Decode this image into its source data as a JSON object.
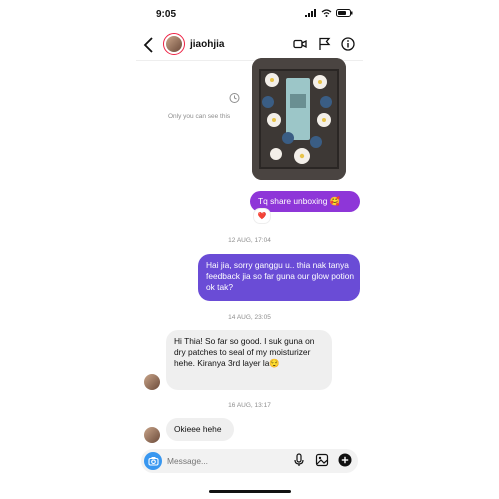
{
  "status": {
    "time": "9:05"
  },
  "header": {
    "username": "jiaohjia"
  },
  "media": {
    "note": "Only you can see this"
  },
  "messages": {
    "m1": "Tq share unboxing 🥰",
    "m1_reaction": "❤️",
    "ts1": "12 AUG, 17:04",
    "m2": "Hai jia, sorry ganggu u..  thia nak tanya feedback jia so far guna our glow potion ok tak?",
    "ts2": "14 AUG, 23:05",
    "m3": "Hi Thia! So far so good. I suk guna on dry patches to seal of my moisturizer hehe. Kiranya 3rd layer la😌",
    "ts3": "16 AUG, 13:17",
    "m4": "Okieee hehe"
  },
  "composer": {
    "placeholder": "Message..."
  },
  "colors": {
    "outgoing_1": "#8e36d8",
    "outgoing_2": "#6a4cd6",
    "incoming": "#efefef",
    "camera": "#3897f0"
  }
}
